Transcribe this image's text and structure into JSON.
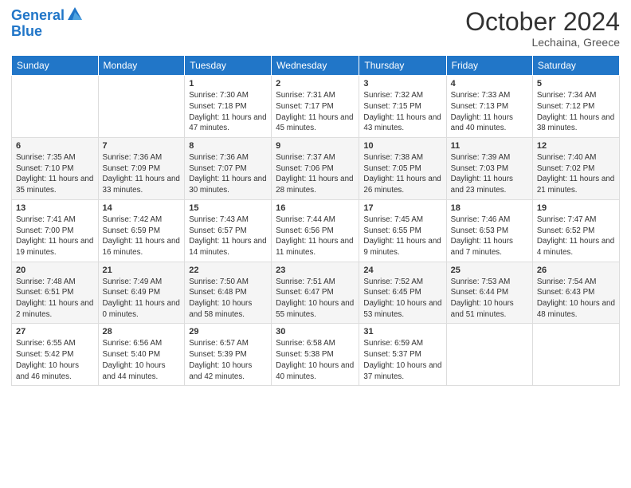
{
  "logo": {
    "line1": "General",
    "line2": "Blue"
  },
  "title": "October 2024",
  "subtitle": "Lechaina, Greece",
  "days_header": [
    "Sunday",
    "Monday",
    "Tuesday",
    "Wednesday",
    "Thursday",
    "Friday",
    "Saturday"
  ],
  "weeks": [
    [
      {
        "day": "",
        "sunrise": "",
        "sunset": "",
        "daylight": ""
      },
      {
        "day": "",
        "sunrise": "",
        "sunset": "",
        "daylight": ""
      },
      {
        "day": "1",
        "sunrise": "Sunrise: 7:30 AM",
        "sunset": "Sunset: 7:18 PM",
        "daylight": "Daylight: 11 hours and 47 minutes."
      },
      {
        "day": "2",
        "sunrise": "Sunrise: 7:31 AM",
        "sunset": "Sunset: 7:17 PM",
        "daylight": "Daylight: 11 hours and 45 minutes."
      },
      {
        "day": "3",
        "sunrise": "Sunrise: 7:32 AM",
        "sunset": "Sunset: 7:15 PM",
        "daylight": "Daylight: 11 hours and 43 minutes."
      },
      {
        "day": "4",
        "sunrise": "Sunrise: 7:33 AM",
        "sunset": "Sunset: 7:13 PM",
        "daylight": "Daylight: 11 hours and 40 minutes."
      },
      {
        "day": "5",
        "sunrise": "Sunrise: 7:34 AM",
        "sunset": "Sunset: 7:12 PM",
        "daylight": "Daylight: 11 hours and 38 minutes."
      }
    ],
    [
      {
        "day": "6",
        "sunrise": "Sunrise: 7:35 AM",
        "sunset": "Sunset: 7:10 PM",
        "daylight": "Daylight: 11 hours and 35 minutes."
      },
      {
        "day": "7",
        "sunrise": "Sunrise: 7:36 AM",
        "sunset": "Sunset: 7:09 PM",
        "daylight": "Daylight: 11 hours and 33 minutes."
      },
      {
        "day": "8",
        "sunrise": "Sunrise: 7:36 AM",
        "sunset": "Sunset: 7:07 PM",
        "daylight": "Daylight: 11 hours and 30 minutes."
      },
      {
        "day": "9",
        "sunrise": "Sunrise: 7:37 AM",
        "sunset": "Sunset: 7:06 PM",
        "daylight": "Daylight: 11 hours and 28 minutes."
      },
      {
        "day": "10",
        "sunrise": "Sunrise: 7:38 AM",
        "sunset": "Sunset: 7:05 PM",
        "daylight": "Daylight: 11 hours and 26 minutes."
      },
      {
        "day": "11",
        "sunrise": "Sunrise: 7:39 AM",
        "sunset": "Sunset: 7:03 PM",
        "daylight": "Daylight: 11 hours and 23 minutes."
      },
      {
        "day": "12",
        "sunrise": "Sunrise: 7:40 AM",
        "sunset": "Sunset: 7:02 PM",
        "daylight": "Daylight: 11 hours and 21 minutes."
      }
    ],
    [
      {
        "day": "13",
        "sunrise": "Sunrise: 7:41 AM",
        "sunset": "Sunset: 7:00 PM",
        "daylight": "Daylight: 11 hours and 19 minutes."
      },
      {
        "day": "14",
        "sunrise": "Sunrise: 7:42 AM",
        "sunset": "Sunset: 6:59 PM",
        "daylight": "Daylight: 11 hours and 16 minutes."
      },
      {
        "day": "15",
        "sunrise": "Sunrise: 7:43 AM",
        "sunset": "Sunset: 6:57 PM",
        "daylight": "Daylight: 11 hours and 14 minutes."
      },
      {
        "day": "16",
        "sunrise": "Sunrise: 7:44 AM",
        "sunset": "Sunset: 6:56 PM",
        "daylight": "Daylight: 11 hours and 11 minutes."
      },
      {
        "day": "17",
        "sunrise": "Sunrise: 7:45 AM",
        "sunset": "Sunset: 6:55 PM",
        "daylight": "Daylight: 11 hours and 9 minutes."
      },
      {
        "day": "18",
        "sunrise": "Sunrise: 7:46 AM",
        "sunset": "Sunset: 6:53 PM",
        "daylight": "Daylight: 11 hours and 7 minutes."
      },
      {
        "day": "19",
        "sunrise": "Sunrise: 7:47 AM",
        "sunset": "Sunset: 6:52 PM",
        "daylight": "Daylight: 11 hours and 4 minutes."
      }
    ],
    [
      {
        "day": "20",
        "sunrise": "Sunrise: 7:48 AM",
        "sunset": "Sunset: 6:51 PM",
        "daylight": "Daylight: 11 hours and 2 minutes."
      },
      {
        "day": "21",
        "sunrise": "Sunrise: 7:49 AM",
        "sunset": "Sunset: 6:49 PM",
        "daylight": "Daylight: 11 hours and 0 minutes."
      },
      {
        "day": "22",
        "sunrise": "Sunrise: 7:50 AM",
        "sunset": "Sunset: 6:48 PM",
        "daylight": "Daylight: 10 hours and 58 minutes."
      },
      {
        "day": "23",
        "sunrise": "Sunrise: 7:51 AM",
        "sunset": "Sunset: 6:47 PM",
        "daylight": "Daylight: 10 hours and 55 minutes."
      },
      {
        "day": "24",
        "sunrise": "Sunrise: 7:52 AM",
        "sunset": "Sunset: 6:45 PM",
        "daylight": "Daylight: 10 hours and 53 minutes."
      },
      {
        "day": "25",
        "sunrise": "Sunrise: 7:53 AM",
        "sunset": "Sunset: 6:44 PM",
        "daylight": "Daylight: 10 hours and 51 minutes."
      },
      {
        "day": "26",
        "sunrise": "Sunrise: 7:54 AM",
        "sunset": "Sunset: 6:43 PM",
        "daylight": "Daylight: 10 hours and 48 minutes."
      }
    ],
    [
      {
        "day": "27",
        "sunrise": "Sunrise: 6:55 AM",
        "sunset": "Sunset: 5:42 PM",
        "daylight": "Daylight: 10 hours and 46 minutes."
      },
      {
        "day": "28",
        "sunrise": "Sunrise: 6:56 AM",
        "sunset": "Sunset: 5:40 PM",
        "daylight": "Daylight: 10 hours and 44 minutes."
      },
      {
        "day": "29",
        "sunrise": "Sunrise: 6:57 AM",
        "sunset": "Sunset: 5:39 PM",
        "daylight": "Daylight: 10 hours and 42 minutes."
      },
      {
        "day": "30",
        "sunrise": "Sunrise: 6:58 AM",
        "sunset": "Sunset: 5:38 PM",
        "daylight": "Daylight: 10 hours and 40 minutes."
      },
      {
        "day": "31",
        "sunrise": "Sunrise: 6:59 AM",
        "sunset": "Sunset: 5:37 PM",
        "daylight": "Daylight: 10 hours and 37 minutes."
      },
      {
        "day": "",
        "sunrise": "",
        "sunset": "",
        "daylight": ""
      },
      {
        "day": "",
        "sunrise": "",
        "sunset": "",
        "daylight": ""
      }
    ]
  ]
}
